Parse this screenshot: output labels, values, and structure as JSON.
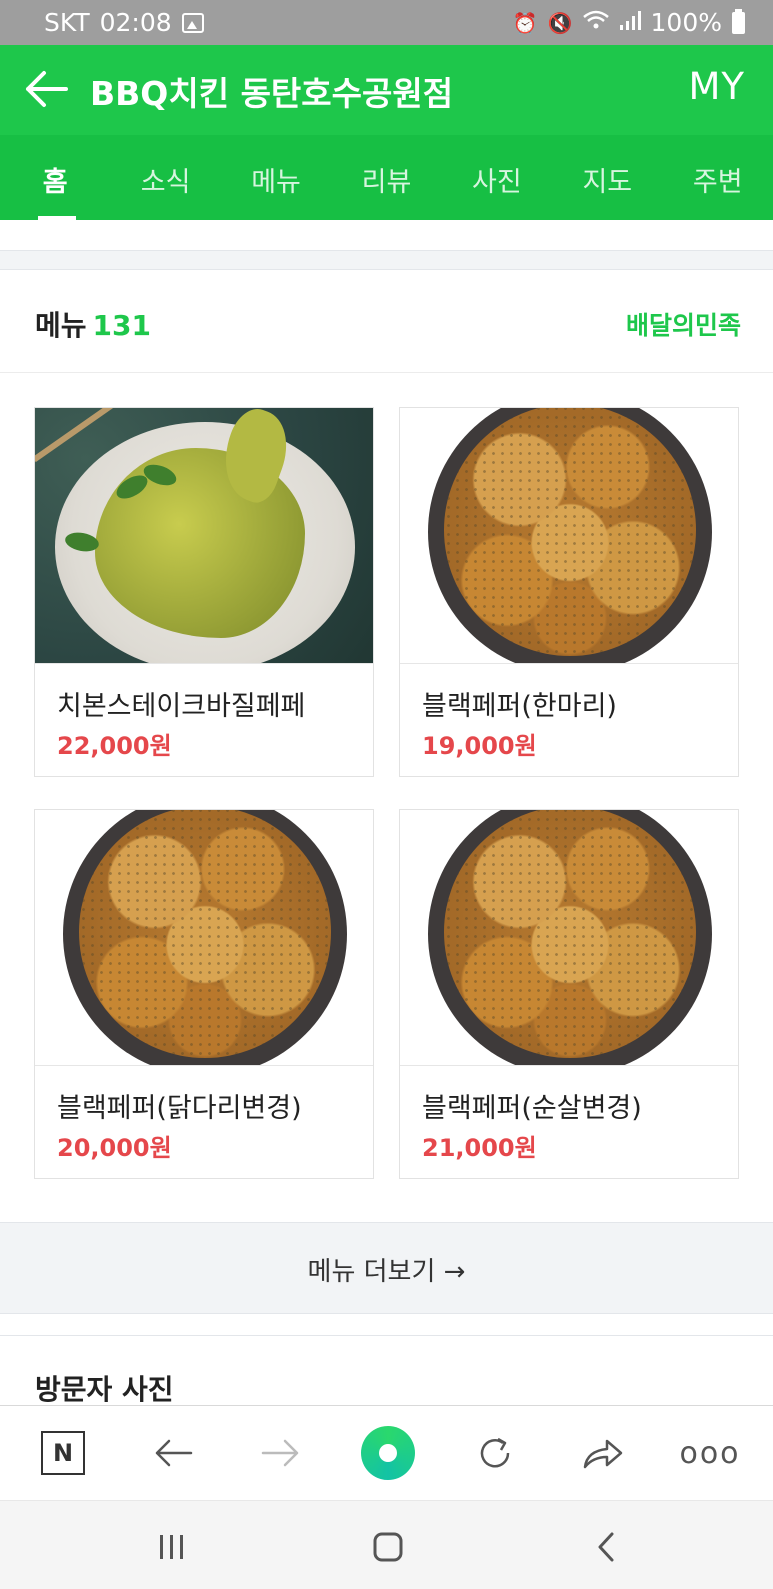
{
  "status_bar": {
    "carrier": "SKT",
    "time": "02:08",
    "battery": "100%",
    "icons": [
      "image-icon",
      "alarm-icon",
      "mute-icon",
      "wifi-icon",
      "signal-icon",
      "battery-icon"
    ]
  },
  "header": {
    "title": "BBQ치킨 동탄호수공원점",
    "my_label": "MY",
    "back_icon": "back-arrow-icon",
    "color": "#1ec74b"
  },
  "tabs": [
    {
      "label": "홈",
      "active": true
    },
    {
      "label": "소식",
      "active": false
    },
    {
      "label": "메뉴",
      "active": false
    },
    {
      "label": "리뷰",
      "active": false
    },
    {
      "label": "사진",
      "active": false
    },
    {
      "label": "지도",
      "active": false
    },
    {
      "label": "주변",
      "active": false
    }
  ],
  "menu_section": {
    "label": "메뉴",
    "count": "131",
    "delivery_link": "배달의민족",
    "items": [
      {
        "name": "치본스테이크바질페페",
        "price": "22,000원"
      },
      {
        "name": "블랙페퍼(한마리)",
        "price": "19,000원"
      },
      {
        "name": "블랙페퍼(닭다리변경)",
        "price": "20,000원"
      },
      {
        "name": "블랙페퍼(순살변경)",
        "price": "21,000원"
      }
    ],
    "more_button": "메뉴 더보기 →"
  },
  "visitor_section": {
    "label": "방문자 사진"
  },
  "browser_toolbar": {
    "items": [
      "naver-home-icon",
      "back-icon",
      "forward-icon",
      "green-dot-icon",
      "refresh-icon",
      "share-icon",
      "more-icon"
    ],
    "more_label": "ooo"
  },
  "colors": {
    "brand_green": "#1ec74b",
    "price_red": "#e5474b"
  }
}
